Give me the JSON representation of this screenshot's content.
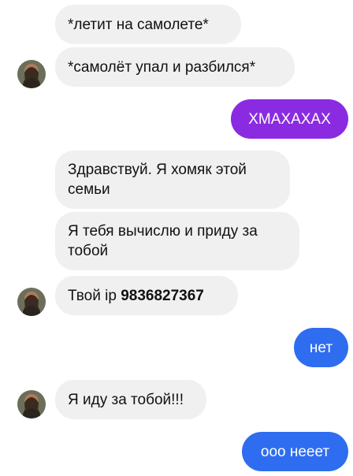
{
  "colors": {
    "incoming_bg": "#f0f0f0",
    "outgoing_purple": "#8a2be2",
    "outgoing_blue": "#2f6df0"
  },
  "messages": [
    {
      "side": "in",
      "text": "*летит на самолете*"
    },
    {
      "side": "in",
      "text": "*самолёт упал и разбился*"
    },
    {
      "side": "out",
      "text": "ХМАХАХАХ"
    },
    {
      "side": "in",
      "text": "Здравствуй. Я хомяк этой семьи"
    },
    {
      "side": "in",
      "text": "Я тебя вычислю и приду за тобой"
    },
    {
      "side": "in",
      "text_prefix": "Твой ip ",
      "ip": "9836827367"
    },
    {
      "side": "out",
      "text": "нет"
    },
    {
      "side": "in",
      "text": "Я иду за тобой!!!"
    },
    {
      "side": "out",
      "text": "ооо нееет"
    }
  ],
  "avatar": {
    "icon": "profile-photo-avatar"
  }
}
